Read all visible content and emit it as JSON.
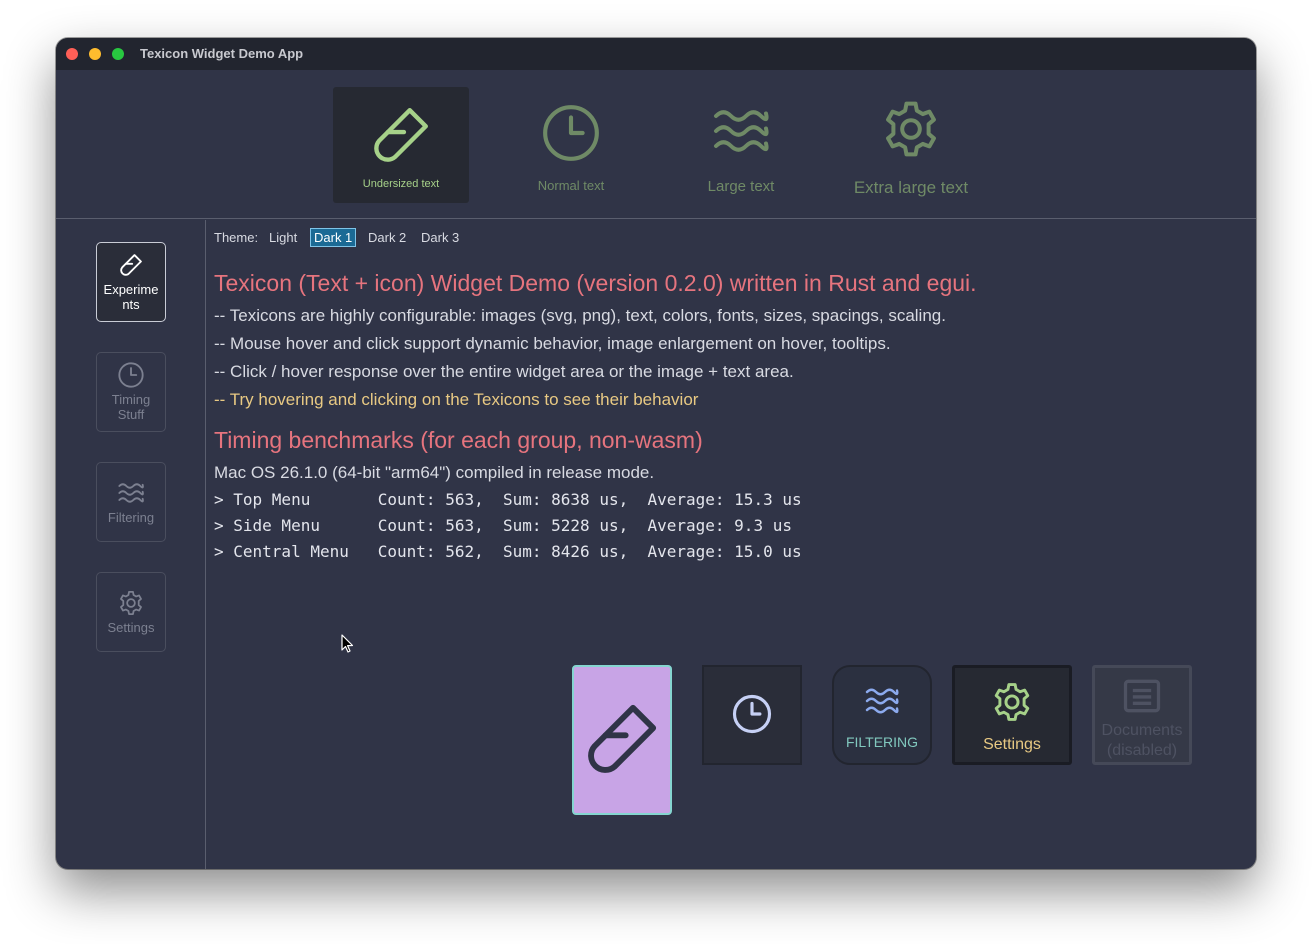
{
  "window": {
    "title": "Texicon Widget Demo App"
  },
  "top_menu": {
    "items": [
      {
        "label": "Undersized text",
        "icon": "test-tube-icon",
        "selected": true
      },
      {
        "label": "Normal text",
        "icon": "clock-icon"
      },
      {
        "label": "Large text",
        "icon": "waves-icon"
      },
      {
        "label": "Extra large text",
        "icon": "gear-icon"
      }
    ]
  },
  "side_menu": {
    "items": [
      {
        "label_l1": "Experime",
        "label_l2": "nts",
        "icon": "test-tube-icon",
        "selected": true
      },
      {
        "label_l1": "Timing",
        "label_l2": "Stuff",
        "icon": "clock-icon"
      },
      {
        "label_l1": "Filtering",
        "label_l2": "",
        "icon": "waves-icon"
      },
      {
        "label_l1": "Settings",
        "label_l2": "",
        "icon": "gear-icon"
      }
    ]
  },
  "theme": {
    "label": "Theme:",
    "options": [
      "Light",
      "Dark 1",
      "Dark 2",
      "Dark 3"
    ],
    "selected": "Dark 1"
  },
  "content": {
    "heading1": "Texicon (Text + icon) Widget Demo (version 0.2.0) written in Rust and egui.",
    "lines": [
      "-- Texicons are highly configurable: images (svg, png), text, colors, fonts, sizes, spacings, scaling.",
      "-- Mouse hover and click support dynamic behavior, image enlargement on hover, tooltips.",
      "-- Click / hover response over the entire widget area or the image + text area."
    ],
    "hover_hint": "-- Try hovering and clicking on the Texicons to see their behavior",
    "heading2": "Timing benchmarks (for each group, non-wasm)",
    "os_line": "Mac OS 26.1.0 (64-bit \"arm64\") compiled in release mode.",
    "benchmarks": [
      "> Top Menu       Count: 563,  Sum: 8638 us,  Average: 15.3 us",
      "> Side Menu      Count: 563,  Sum: 5228 us,  Average: 9.3 us",
      "> Central Menu   Count: 562,  Sum: 8426 us,  Average: 15.0 us"
    ]
  },
  "central_menu": {
    "filtering_label": "FILTERING",
    "settings_label": "Settings",
    "documents_label_l1": "Documents",
    "documents_label_l2": "(disabled)"
  },
  "colors": {
    "background": "#303447",
    "heading": "#e6747e",
    "hover_hint": "#e8c983",
    "accent_green": "#a6d189",
    "muted_green": "#6f8a66",
    "purple_button": "#c8a4e6",
    "filter_blue": "#8caaee",
    "filter_teal": "#81c8be"
  }
}
